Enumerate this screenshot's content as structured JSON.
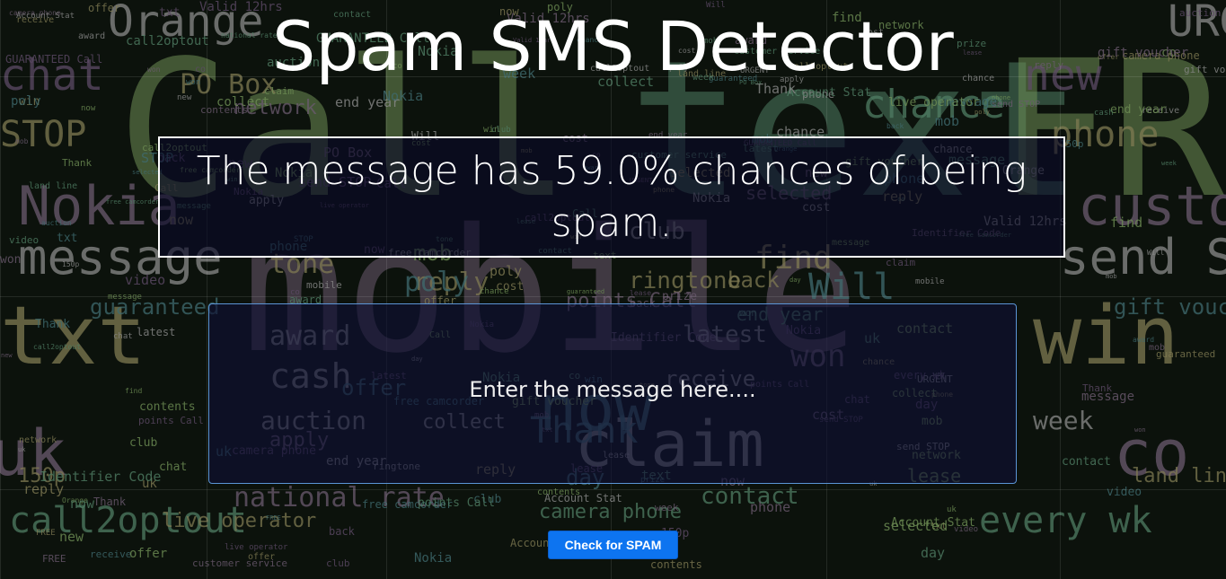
{
  "page": {
    "title": "Spam SMS Detector"
  },
  "result": {
    "text": "The message has 59.0% chances of being spam."
  },
  "form": {
    "message_placeholder": "Enter the message here....",
    "message_value": "",
    "submit_label": "Check for SPAM"
  },
  "background": {
    "type": "word-cloud",
    "words": [
      "Call",
      "text",
      "FREE",
      "mobile",
      "claim",
      "now",
      "txt",
      "win",
      "uk",
      "co",
      "chat",
      "new",
      "Orange",
      "URGENT",
      "STOP",
      "phone",
      "chance",
      "PO Box",
      "Will",
      "won",
      "award",
      "cash",
      "find",
      "Nokia",
      "customer service",
      "message",
      "send STOP",
      "ringtone",
      "latest",
      "receive",
      "reply",
      "tone",
      "poly",
      "Thank",
      "auction",
      "week",
      "150p",
      "land line",
      "national rate",
      "day",
      "call2optout",
      "every wk",
      "live operator",
      "camera phone",
      "offer",
      "end year",
      "points Call",
      "mob",
      "club",
      "back",
      "apply",
      "guaranteed",
      "gift voucher",
      "network",
      "selected",
      "collect",
      "contact",
      "lease",
      "Valid 12hrs",
      "cost",
      "prize",
      "contents",
      "Identifier Code",
      "free camcorder",
      "video",
      "GUARANTEED Call",
      "Account Stat"
    ],
    "colors": [
      "#6f8f55",
      "#4f7d63",
      "#6b5a6f",
      "#8a8a8a",
      "#3f6b6f",
      "#7f7a52",
      "#5d4a66"
    ]
  }
}
